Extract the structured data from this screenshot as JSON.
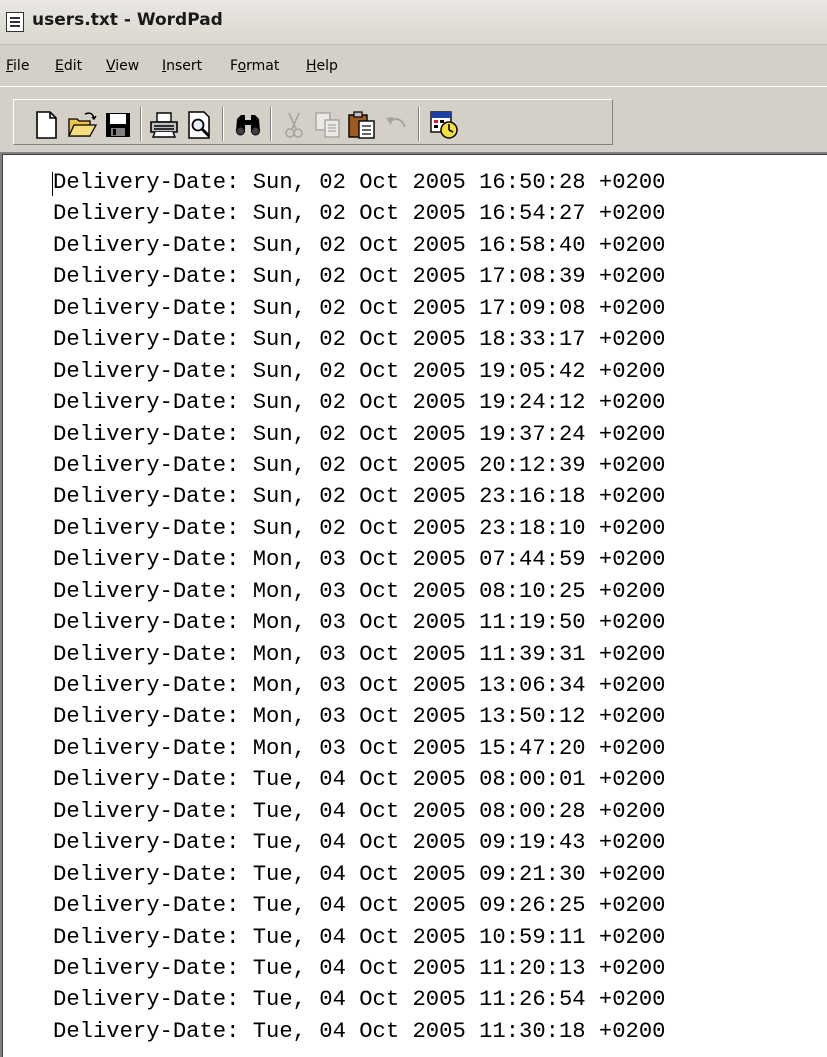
{
  "window": {
    "title": "users.txt - WordPad"
  },
  "menu": {
    "items": [
      {
        "label": "File",
        "accel_index": 0
      },
      {
        "label": "Edit",
        "accel_index": 0
      },
      {
        "label": "View",
        "accel_index": 0
      },
      {
        "label": "Insert",
        "accel_index": 0
      },
      {
        "label": "Format",
        "accel_index": 1
      },
      {
        "label": "Help",
        "accel_index": 0
      }
    ]
  },
  "toolbar": {
    "buttons": [
      {
        "name": "new-document-icon",
        "enabled": true
      },
      {
        "name": "open-folder-icon",
        "enabled": true
      },
      {
        "name": "save-disk-icon",
        "enabled": true
      },
      {
        "name": "print-icon",
        "enabled": true
      },
      {
        "name": "print-preview-icon",
        "enabled": true
      },
      {
        "name": "find-binoculars-icon",
        "enabled": true
      },
      {
        "name": "cut-scissors-icon",
        "enabled": false
      },
      {
        "name": "copy-icon",
        "enabled": false
      },
      {
        "name": "paste-clipboard-icon",
        "enabled": true
      },
      {
        "name": "undo-icon",
        "enabled": false
      },
      {
        "name": "insert-date-time-icon",
        "enabled": true
      }
    ]
  },
  "document": {
    "lines": [
      "Delivery-Date: Sun, 02 Oct 2005 16:50:28 +0200",
      "Delivery-Date: Sun, 02 Oct 2005 16:54:27 +0200",
      "Delivery-Date: Sun, 02 Oct 2005 16:58:40 +0200",
      "Delivery-Date: Sun, 02 Oct 2005 17:08:39 +0200",
      "Delivery-Date: Sun, 02 Oct 2005 17:09:08 +0200",
      "Delivery-Date: Sun, 02 Oct 2005 18:33:17 +0200",
      "Delivery-Date: Sun, 02 Oct 2005 19:05:42 +0200",
      "Delivery-Date: Sun, 02 Oct 2005 19:24:12 +0200",
      "Delivery-Date: Sun, 02 Oct 2005 19:37:24 +0200",
      "Delivery-Date: Sun, 02 Oct 2005 20:12:39 +0200",
      "Delivery-Date: Sun, 02 Oct 2005 23:16:18 +0200",
      "Delivery-Date: Sun, 02 Oct 2005 23:18:10 +0200",
      "Delivery-Date: Mon, 03 Oct 2005 07:44:59 +0200",
      "Delivery-Date: Mon, 03 Oct 2005 08:10:25 +0200",
      "Delivery-Date: Mon, 03 Oct 2005 11:19:50 +0200",
      "Delivery-Date: Mon, 03 Oct 2005 11:39:31 +0200",
      "Delivery-Date: Mon, 03 Oct 2005 13:06:34 +0200",
      "Delivery-Date: Mon, 03 Oct 2005 13:50:12 +0200",
      "Delivery-Date: Mon, 03 Oct 2005 15:47:20 +0200",
      "Delivery-Date: Tue, 04 Oct 2005 08:00:01 +0200",
      "Delivery-Date: Tue, 04 Oct 2005 08:00:28 +0200",
      "Delivery-Date: Tue, 04 Oct 2005 09:19:43 +0200",
      "Delivery-Date: Tue, 04 Oct 2005 09:21:30 +0200",
      "Delivery-Date: Tue, 04 Oct 2005 09:26:25 +0200",
      "Delivery-Date: Tue, 04 Oct 2005 10:59:11 +0200",
      "Delivery-Date: Tue, 04 Oct 2005 11:20:13 +0200",
      "Delivery-Date: Tue, 04 Oct 2005 11:26:54 +0200",
      "Delivery-Date: Tue, 04 Oct 2005 11:30:18 +0200"
    ]
  },
  "colors": {
    "chrome": "#d4d0c8",
    "document_bg": "#ffffff",
    "text": "#000000"
  }
}
